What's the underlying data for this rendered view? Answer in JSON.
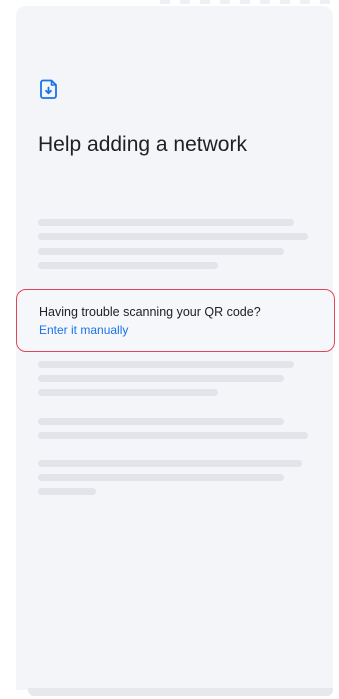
{
  "screen": {
    "title": "Help adding a network",
    "icon": "file-download-icon",
    "accent_color": "#1a73e8",
    "highlight_color": "#e0475d"
  },
  "callout": {
    "question": "Having trouble scanning your QR code?",
    "link_label": "Enter it manually"
  }
}
